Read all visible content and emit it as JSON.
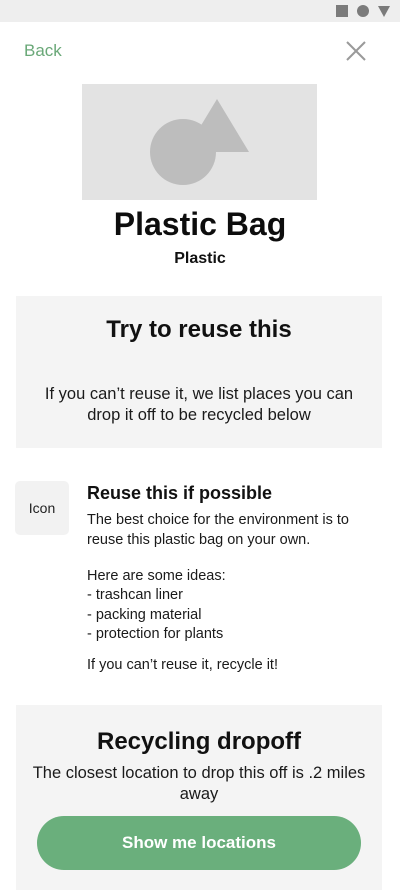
{
  "status_bar": {
    "icons": [
      "square-icon",
      "circle-icon",
      "triangle-icon"
    ]
  },
  "header": {
    "back_label": "Back",
    "close_icon": "close-icon"
  },
  "item": {
    "image_icon": "shapes-placeholder-icon",
    "name": "Plastic Bag",
    "material": "Plastic"
  },
  "reuse_card": {
    "title": "Try to reuse this",
    "body": "If you can’t reuse it, we list places you can drop it off to be recycled below"
  },
  "tip": {
    "icon_label": "Icon",
    "title": "Reuse this if possible",
    "intro": "The best choice for the environment is to reuse this plastic bag on your own.",
    "ideas_heading": "Here are some ideas:",
    "ideas": [
      "- trashcan liner",
      "- packing material",
      "- protection for plants"
    ],
    "footer": "If you can’t reuse it, recycle it!"
  },
  "dropoff": {
    "title": "Recycling dropoff",
    "body": "The closest location to drop this off is .2 miles away",
    "button_label": "Show me locations"
  },
  "colors": {
    "accent": "#6aaf7c",
    "link": "#6aa878",
    "card_background": "#f4f4f4",
    "placeholder": "#e3e3e3"
  }
}
